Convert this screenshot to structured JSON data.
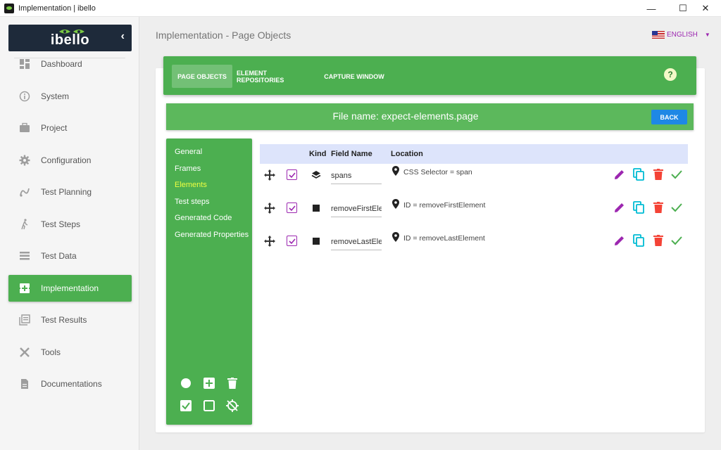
{
  "window": {
    "title": "Implementation | ibello",
    "minimize": "—",
    "maximize": "☐",
    "close": "✕"
  },
  "sidebar": {
    "brand": "ibello",
    "collapse": "‹",
    "items": [
      {
        "label": "Dashboard",
        "icon": "dashboard-icon"
      },
      {
        "label": "System",
        "icon": "info-icon"
      },
      {
        "label": "Project",
        "icon": "briefcase-icon"
      },
      {
        "label": "Configuration",
        "icon": "gear-icon"
      },
      {
        "label": "Test Planning",
        "icon": "planning-icon"
      },
      {
        "label": "Test Steps",
        "icon": "walking-icon"
      },
      {
        "label": "Test Data",
        "icon": "list-icon"
      },
      {
        "label": "Implementation",
        "icon": "implementation-icon",
        "active": true
      },
      {
        "label": "Test Results",
        "icon": "results-icon"
      },
      {
        "label": "Tools",
        "icon": "tools-icon"
      },
      {
        "label": "Documentations",
        "icon": "document-icon"
      }
    ]
  },
  "header": {
    "title": "Implementation - Page Objects",
    "language": "ENGLISH"
  },
  "tabs": {
    "page_objects": "PAGE OBJECTS",
    "element_repositories": "ELEMENT REPOSITORIES",
    "capture_window": "CAPTURE WINDOW",
    "help": "?"
  },
  "file": {
    "name_label": "File name: expect-elements.page",
    "back": "BACK"
  },
  "menu": {
    "general": "General",
    "frames": "Frames",
    "elements": "Elements",
    "test_steps": "Test steps",
    "generated_code": "Generated Code",
    "generated_properties": "Generated Properties"
  },
  "table": {
    "headers": {
      "kind": "Kind",
      "field_name": "Field Name",
      "location": "Location"
    },
    "rows": [
      {
        "field_name": "spans",
        "kind_icon": "layers-icon",
        "location": "CSS Selector = span",
        "checked": true
      },
      {
        "field_name": "removeFirstElement",
        "kind_icon": "square-icon",
        "location": "ID = removeFirstElement",
        "checked": true
      },
      {
        "field_name": "removeLastElement",
        "kind_icon": "square-icon",
        "location": "ID = removeLastElement",
        "checked": true
      }
    ]
  },
  "colors": {
    "green": "#4caf50",
    "purple": "#9c27b0",
    "cyan": "#00bcd4",
    "red": "#f44336",
    "blue": "#1e88e5",
    "yellow_active": "#eeff41"
  }
}
